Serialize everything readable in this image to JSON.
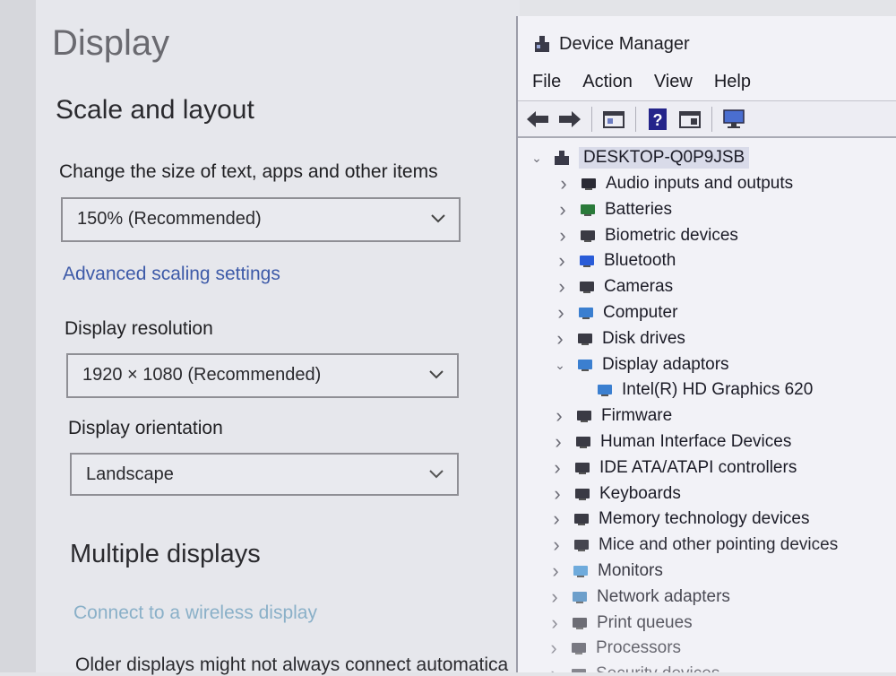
{
  "settings": {
    "page_title": "Display",
    "section_title": "Scale and layout",
    "scale_label": "Change the size of text, apps and other items",
    "scale_value": "150% (Recommended)",
    "advanced_link": "Advanced scaling settings",
    "resolution_label": "Display resolution",
    "resolution_value": "1920 × 1080 (Recommended)",
    "orientation_label": "Display orientation",
    "orientation_value": "Landscape",
    "multiple_title": "Multiple displays",
    "wireless_link": "Connect to a wireless display",
    "older_text": "Older displays might not always connect automatica"
  },
  "device_manager": {
    "title": "Device Manager",
    "menu": [
      "File",
      "Action",
      "View",
      "Help"
    ],
    "toolbar_icons": [
      "back-arrow-icon",
      "forward-arrow-icon",
      "properties-icon",
      "help-icon",
      "update-driver-icon",
      "monitor-icon"
    ],
    "root": "DESKTOP-Q0P9JSB",
    "categories": [
      {
        "label": "Audio inputs and outputs",
        "icon": "speaker-icon",
        "expanded": false
      },
      {
        "label": "Batteries",
        "icon": "battery-icon",
        "expanded": false
      },
      {
        "label": "Biometric devices",
        "icon": "fingerprint-icon",
        "expanded": false
      },
      {
        "label": "Bluetooth",
        "icon": "bluetooth-icon",
        "expanded": false
      },
      {
        "label": "Cameras",
        "icon": "camera-icon",
        "expanded": false
      },
      {
        "label": "Computer",
        "icon": "computer-icon",
        "expanded": false
      },
      {
        "label": "Disk drives",
        "icon": "disk-drive-icon",
        "expanded": false
      },
      {
        "label": "Display adaptors",
        "icon": "display-adapter-icon",
        "expanded": true
      },
      {
        "label": "Intel(R) HD Graphics 620",
        "icon": "display-adapter-icon",
        "child": true
      },
      {
        "label": "Firmware",
        "icon": "firmware-icon",
        "expanded": false
      },
      {
        "label": "Human Interface Devices",
        "icon": "hid-icon",
        "expanded": false
      },
      {
        "label": "IDE ATA/ATAPI controllers",
        "icon": "ide-controller-icon",
        "expanded": false
      },
      {
        "label": "Keyboards",
        "icon": "keyboard-icon",
        "expanded": false
      },
      {
        "label": "Memory technology devices",
        "icon": "memory-icon",
        "expanded": false
      },
      {
        "label": "Mice and other pointing devices",
        "icon": "mouse-icon",
        "expanded": false
      },
      {
        "label": "Monitors",
        "icon": "monitor-icon",
        "expanded": false
      },
      {
        "label": "Network adapters",
        "icon": "network-icon",
        "expanded": false
      },
      {
        "label": "Print queues",
        "icon": "printer-icon",
        "expanded": false
      },
      {
        "label": "Processors",
        "icon": "processor-icon",
        "expanded": false
      },
      {
        "label": "Security devices",
        "icon": "security-icon",
        "expanded": false
      }
    ]
  },
  "colors": {
    "link": "#3d5aa8",
    "link_faded": "#8ab0c8",
    "selection": "#d9dbe9"
  }
}
